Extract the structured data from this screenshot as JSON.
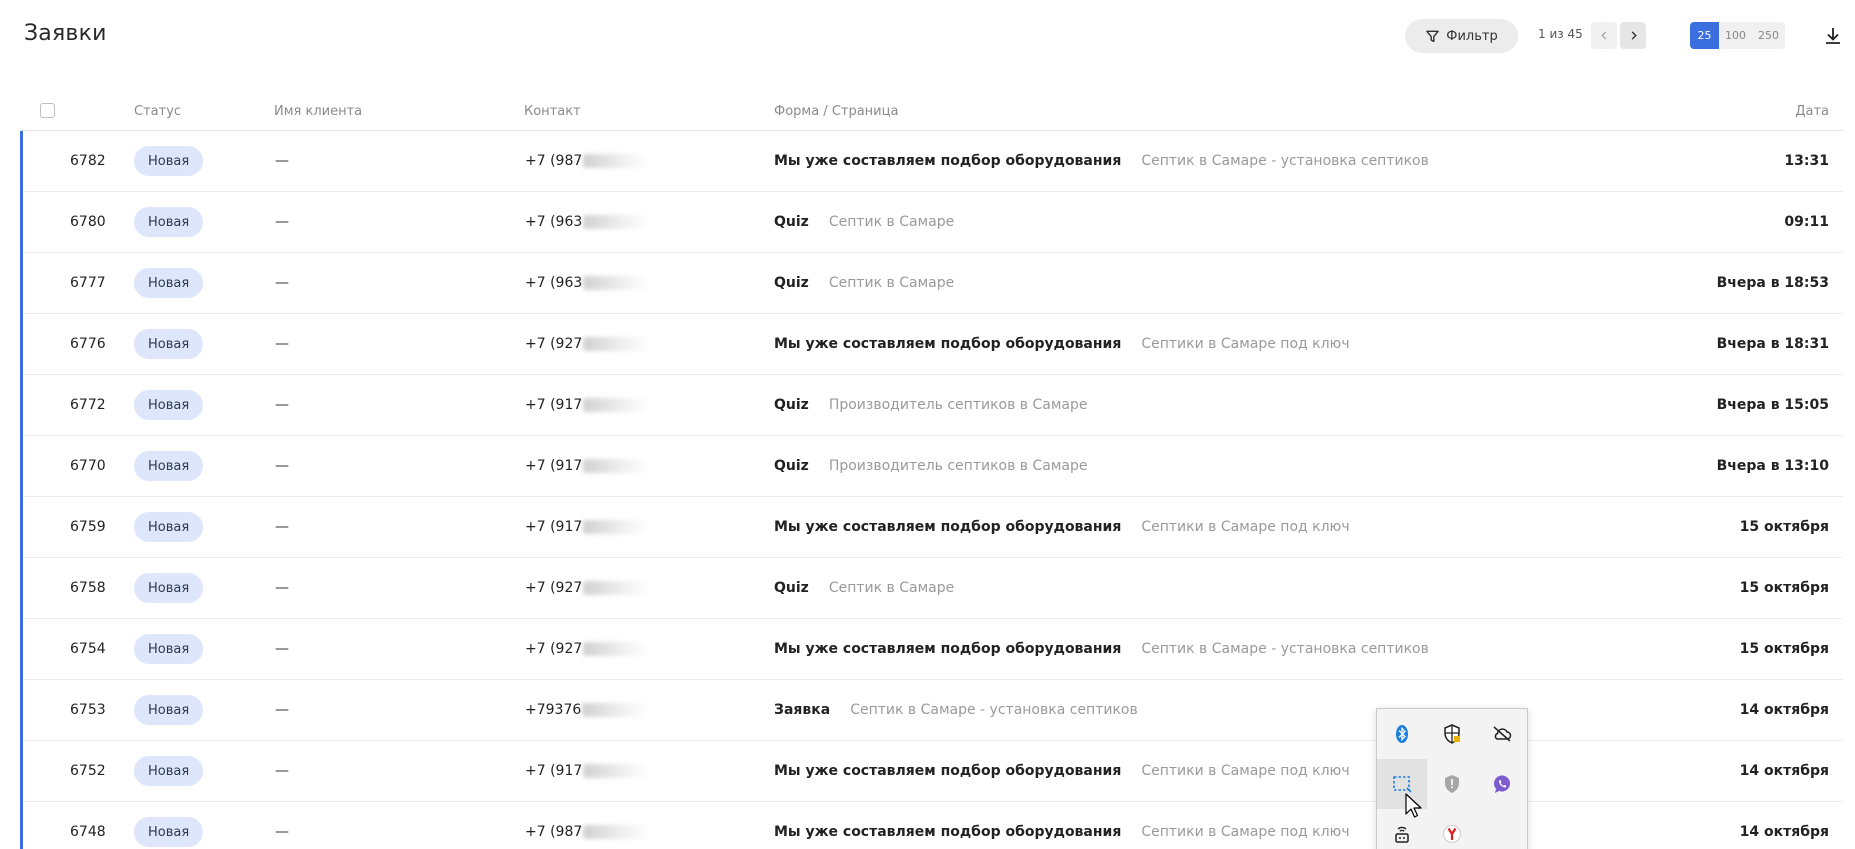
{
  "header": {
    "title": "Заявки",
    "filter_label": "Фильтр",
    "pagination": "1 из 45",
    "page_sizes": [
      "25",
      "100",
      "250"
    ],
    "active_page_size": "25"
  },
  "table": {
    "columns": {
      "status": "Статус",
      "client_name": "Имя клиента",
      "contact": "Контакт",
      "form_page": "Форма / Страница",
      "date": "Дата"
    },
    "rows": [
      {
        "id": "6782",
        "status": "Новая",
        "name": "—",
        "contact": "+7 (987",
        "form": "Мы уже составляем подбор оборудования",
        "page": "Септик в Самаре - установка септиков",
        "date": "13:31"
      },
      {
        "id": "6780",
        "status": "Новая",
        "name": "—",
        "contact": "+7 (963",
        "form": "Quiz",
        "page": "Септик в Самаре",
        "date": "09:11"
      },
      {
        "id": "6777",
        "status": "Новая",
        "name": "—",
        "contact": "+7 (963",
        "form": "Quiz",
        "page": "Септик в Самаре",
        "date": "Вчера в 18:53"
      },
      {
        "id": "6776",
        "status": "Новая",
        "name": "—",
        "contact": "+7 (927",
        "form": "Мы уже составляем подбор оборудования",
        "page": "Септики в Самаре под ключ",
        "date": "Вчера в 18:31"
      },
      {
        "id": "6772",
        "status": "Новая",
        "name": "—",
        "contact": "+7 (917",
        "form": "Quiz",
        "page": "Производитель септиков в Самаре",
        "date": "Вчера в 15:05"
      },
      {
        "id": "6770",
        "status": "Новая",
        "name": "—",
        "contact": "+7 (917",
        "form": "Quiz",
        "page": "Производитель септиков в Самаре",
        "date": "Вчера в 13:10"
      },
      {
        "id": "6759",
        "status": "Новая",
        "name": "—",
        "contact": "+7 (917",
        "form": "Мы уже составляем подбор оборудования",
        "page": "Септики в Самаре под ключ",
        "date": "15 октября"
      },
      {
        "id": "6758",
        "status": "Новая",
        "name": "—",
        "contact": "+7 (927",
        "form": "Quiz",
        "page": "Септик в Самаре",
        "date": "15 октября"
      },
      {
        "id": "6754",
        "status": "Новая",
        "name": "—",
        "contact": "+7 (927",
        "form": "Мы уже составляем подбор оборудования",
        "page": "Септик в Самаре - установка септиков",
        "date": "15 октября"
      },
      {
        "id": "6753",
        "status": "Новая",
        "name": "—",
        "contact": "+79376",
        "form": "Заявка",
        "page": "Септик в Самаре - установка септиков",
        "date": "14 октября"
      },
      {
        "id": "6752",
        "status": "Новая",
        "name": "—",
        "contact": "+7 (917",
        "form": "Мы уже составляем подбор оборудования",
        "page": "Септики в Самаре под ключ",
        "date": "14 октября"
      },
      {
        "id": "6748",
        "status": "Новая",
        "name": "—",
        "contact": "+7 (987",
        "form": "Мы уже составляем подбор оборудования",
        "page": "Септики в Самаре под ключ",
        "date": "14 октября"
      }
    ]
  },
  "tray": {
    "icons": [
      "bluetooth-icon",
      "defender-shield-icon",
      "cloud-offline-icon",
      "screen-capture-icon",
      "security-shield-icon",
      "viber-icon",
      "network-router-icon",
      "yandex-browser-icon"
    ]
  },
  "colors": {
    "accent": "#3b6fe0",
    "status_badge_bg": "#dde6fb",
    "muted_text": "#9a9a9a"
  }
}
